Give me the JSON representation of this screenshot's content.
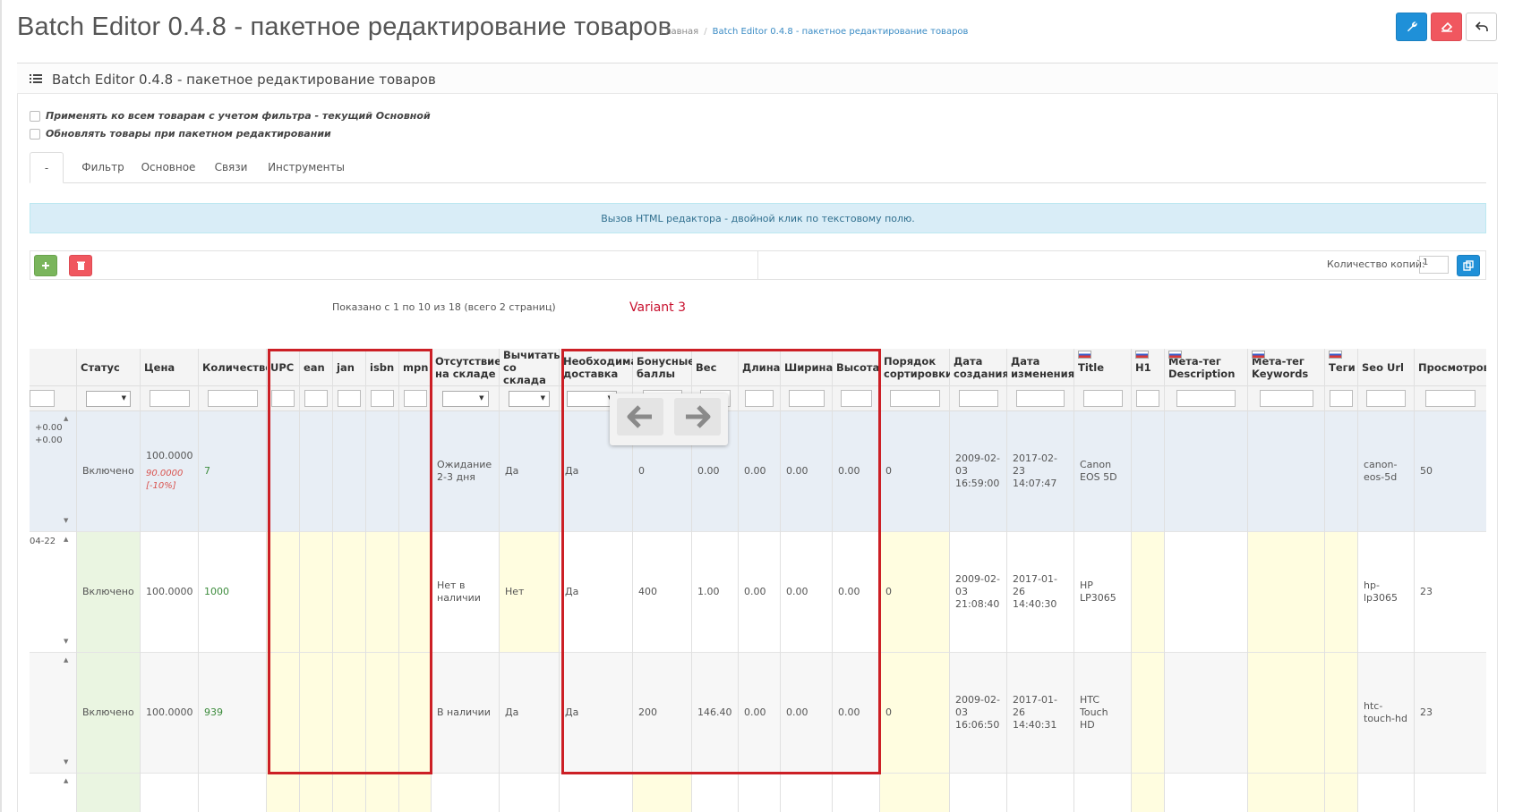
{
  "header": {
    "title": "Batch Editor 0.4.8 - пакетное редактирование товаров",
    "breadcrumb_home": "Главная",
    "breadcrumb_current": "Batch Editor 0.4.8 - пакетное редактирование товаров"
  },
  "toolbar": {
    "settings_icon": "wrench-icon",
    "clear_icon": "eraser-icon",
    "back_icon": "reply-icon"
  },
  "panel": {
    "title": "Batch Editor 0.4.8 - пакетное редактирование товаров"
  },
  "options": {
    "apply_all": "Применять ко всем товарам с учетом фильтра - текущий Основной",
    "update_products": "Обновлять товары при пакетном редактировании"
  },
  "tabs": [
    "-",
    "Фильтр",
    "Основное",
    "Связи",
    "Инструменты"
  ],
  "info": "Вызов HTML редактора - двойной клик по текстовому полю.",
  "actions": {
    "copies_label": "Количество копий:",
    "copies_value": "1"
  },
  "pagination": {
    "shown": "Показано с 1 по 10 из 18 (всего 2 страниц)"
  },
  "annotation": "Variant 3",
  "table": {
    "columns": [
      "",
      "Статус",
      "Цена",
      "Количество",
      "UPC",
      "ean",
      "jan",
      "isbn",
      "mpn",
      "Отсутствие на складе",
      "Вычитать со склада",
      "Необходима доставка",
      "Бонусные баллы",
      "Вес",
      "Длина",
      "Ширина",
      "Высота",
      "Порядок сортировки",
      "Дата создания",
      "Дата изменения",
      "Title",
      "H1",
      "Мета-тег Description",
      "Мета-тег Keywords",
      "Теги",
      "Seo Url",
      "Просмотров"
    ],
    "rows": [
      {
        "c0": "+0.00\n+0.00",
        "status": "Включено",
        "price": "100.0000",
        "special": "90.0000",
        "discount": "[-10%]",
        "qty": "7",
        "stock_status": "Ожидание 2-3 дня",
        "subtract": "Да",
        "shipping": "Да",
        "points": "0",
        "weight": "0.00",
        "length": "0.00",
        "width": "0.00",
        "height": "0.00",
        "sort": "0",
        "added": "2009-02-03 16:59:00",
        "modified": "2017-02-23 14:07:47",
        "title": "Canon EOS 5D",
        "seo": "canon-eos-5d",
        "viewed": "50"
      },
      {
        "c0": "04-22",
        "status": "Включено",
        "price": "100.0000",
        "qty": "1000",
        "stock_status": "Нет в наличии",
        "subtract": "Нет",
        "shipping": "Да",
        "points": "400",
        "weight": "1.00",
        "length": "0.00",
        "width": "0.00",
        "height": "0.00",
        "sort": "0",
        "added": "2009-02-03 21:08:40",
        "modified": "2017-01-26 14:40:30",
        "title": "HP LP3065",
        "seo": "hp-lp3065",
        "viewed": "23"
      },
      {
        "c0": "",
        "status": "Включено",
        "price": "100.0000",
        "qty": "939",
        "stock_status": "В наличии",
        "subtract": "Да",
        "shipping": "Да",
        "points": "200",
        "weight": "146.40",
        "length": "0.00",
        "width": "0.00",
        "height": "0.00",
        "sort": "0",
        "added": "2009-02-03 16:06:50",
        "modified": "2017-01-26 14:40:31",
        "title": "HTC Touch HD",
        "seo": "htc-touch-hd",
        "viewed": "23"
      }
    ]
  }
}
